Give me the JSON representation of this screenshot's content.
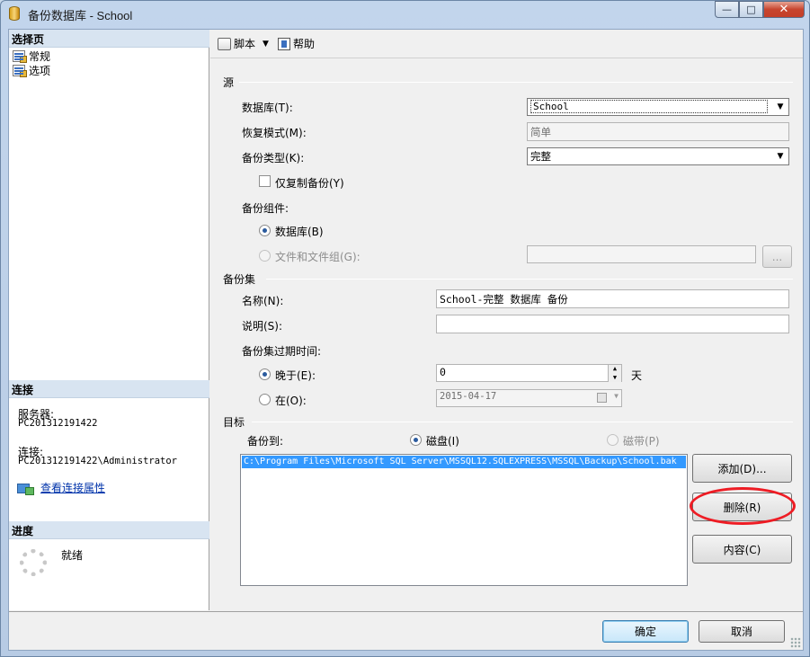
{
  "window": {
    "title": "备份数据库 - School",
    "minimize_glyph": "—",
    "maximize_glyph": "□",
    "close_glyph": "✕"
  },
  "left": {
    "select_page_header": "选择页",
    "pages": [
      "常规",
      "选项"
    ],
    "connection_header": "连接",
    "server_label": "服务器:",
    "server_value": "PC201312191422",
    "connection_label": "连接:",
    "connection_value": "PC201312191422\\Administrator",
    "view_connection_link": "查看连接属性",
    "progress_header": "进度",
    "progress_status": "就绪"
  },
  "toolbar": {
    "script_label": "脚本",
    "script_dropdown_glyph": "▼",
    "help_label": "帮助"
  },
  "source": {
    "group_title": "源",
    "database_label": "数据库(T):",
    "database_value": "School",
    "recovery_label": "恢复模式(M):",
    "recovery_value": "简单",
    "backup_type_label": "备份类型(K):",
    "backup_type_value": "完整",
    "copy_only_label": "仅复制备份(Y)",
    "copy_only_checked": false,
    "component_label": "备份组件:",
    "component_database_label": "数据库(B)",
    "component_files_label": "文件和文件组(G):",
    "files_browse_label": "...",
    "combo_arrow_glyph": "▼"
  },
  "backup_set": {
    "group_title": "备份集",
    "name_label": "名称(N):",
    "name_value": "School-完整 数据库 备份",
    "description_label": "说明(S):",
    "description_value": "",
    "expire_label": "备份集过期时间:",
    "after_label": "晚于(E):",
    "after_value": "0",
    "after_unit": "天",
    "on_label": "在(O):",
    "on_value": "2015-04-17",
    "spin_up_glyph": "▲",
    "spin_down_glyph": "▼"
  },
  "destination": {
    "group_title": "目标",
    "backup_to_label": "备份到:",
    "disk_label": "磁盘(I)",
    "tape_label": "磁带(P)",
    "paths": [
      "C:\\Program Files\\Microsoft SQL Server\\MSSQL12.SQLEXPRESS\\MSSQL\\Backup\\School.bak"
    ],
    "add_button": "添加(D)...",
    "remove_button": "删除(R)",
    "contents_button": "内容(C)"
  },
  "footer": {
    "ok_button": "确定",
    "cancel_button": "取消"
  },
  "colors": {
    "selection": "#3399ff",
    "annotation_ring": "#ee1c24",
    "link": "#0033aa"
  }
}
